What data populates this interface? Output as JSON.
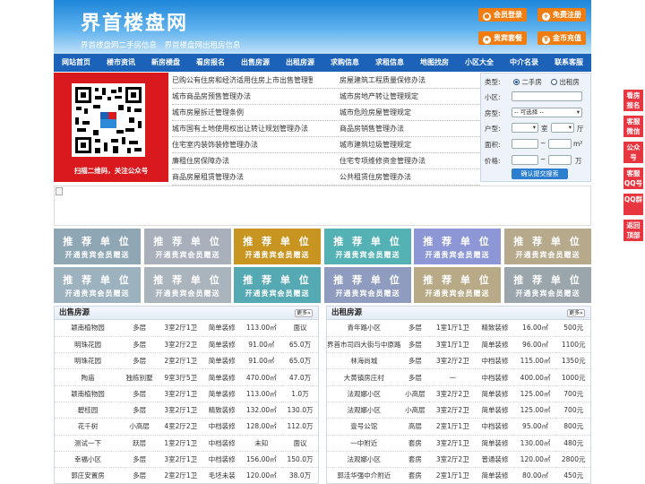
{
  "header": {
    "logo": "界首楼盘网",
    "slogan": "界首楼盘网二手房信息　界首楼盘网出租房信息",
    "buttons": [
      "会员登录",
      "免费注册",
      "贵宾套餐",
      "金币充值"
    ]
  },
  "nav": [
    "网站首页",
    "楼市资讯",
    "新房楼盘",
    "看房报名",
    "出售房源",
    "出租房源",
    "求购信息",
    "求租信息",
    "地图找房",
    "小区大全",
    "中介名录",
    "联系客服"
  ],
  "qr": {
    "caption": "扫描二维码，关注公众号"
  },
  "links": [
    [
      "已购公有住房和经济适用住房上市出售管理暂",
      "房屋建筑工程质量保修办法"
    ],
    [
      "城市商品房预售管理办法",
      "城市房地产转让管理规定"
    ],
    [
      "城市房屋拆迁管理条例",
      "城市危险房屋管理规定"
    ],
    [
      "城市国有土地使用权出让转让规划管理办法",
      "商品房销售管理办法"
    ],
    [
      "住宅室内装饰装修管理办法",
      "城市建筑垃圾管理规定"
    ],
    [
      "廉租住房保障办法",
      "住宅专项维修资金管理办法"
    ],
    [
      "商品房屋租赁管理办法",
      "公共租赁住房管理办法"
    ]
  ],
  "search": {
    "type_label": "类型:",
    "type_options": [
      "二手房",
      "出租房"
    ],
    "community_label": "小区:",
    "house_label": "房型:",
    "house_select": "-- 可选择 --",
    "layout_label": "户型:",
    "room_unit": "室",
    "hall_unit": "厅",
    "area_label": "面积:",
    "area_unit": "m²",
    "price_label": "价格:",
    "price_unit": "万",
    "submit": "确认提交搜索"
  },
  "tiles": {
    "line1": "推 荐 单 位",
    "line2": "开通贵宾会员赠送",
    "colors": [
      "#8fa6b4",
      "#a9b0bb",
      "#c79520",
      "#55b2b4",
      "#8d97d6",
      "#b6a98c",
      "#9cb2bf",
      "#aab4bc",
      "#55a9b3",
      "#8f9cbf",
      "#b8aa86",
      "#9aa6ac"
    ]
  },
  "sale": {
    "title": "出售房源",
    "more": "更多»",
    "rows": [
      [
        "颖南植物园",
        "多层",
        "3室2厅1卫",
        "简单装修",
        "113.00㎡",
        "面议"
      ],
      [
        "明珠花园",
        "多层",
        "3室2厅2卫",
        "简单装修",
        "91.00㎡",
        "65.0万"
      ],
      [
        "明珠花园",
        "多层",
        "2室2厅1卫",
        "简单装修",
        "91.00㎡",
        "65.0万"
      ],
      [
        "陶庙",
        "独栋别墅",
        "9室3厅5卫",
        "简单装修",
        "470.00㎡",
        "47.0万"
      ],
      [
        "颖南植物园",
        "多层",
        "3室2厅1卫",
        "简单装修",
        "113.00㎡",
        "1.0万"
      ],
      [
        "碧桂园",
        "多层",
        "3室2厅1卫",
        "精致装修",
        "132.00㎡",
        "130.0万"
      ],
      [
        "花千树",
        "小高层",
        "4室2厅2卫",
        "中档装修",
        "128.00㎡",
        "112.0万"
      ],
      [
        "测试一下",
        "跃层",
        "1室2厅1卫",
        "中档装修",
        "未知",
        "面议"
      ],
      [
        "幸福小区",
        "多层",
        "3室2厅1卫",
        "中档装修",
        "156.00㎡",
        "150.0万"
      ],
      [
        "郭庄安置房",
        "多层",
        "2室2厅1卫",
        "毛坯未装",
        "120.00㎡",
        "38.0万"
      ]
    ]
  },
  "rent": {
    "title": "出租房源",
    "more": "更多»",
    "rows": [
      [
        "青年路小区",
        "多层",
        "1室1厅1卫",
        "精致装修",
        "16.00㎡",
        "500元"
      ],
      [
        "界首市司四大街与中原路",
        "多层",
        "3室1厅1卫",
        "简单装修",
        "96.00㎡",
        "1100元"
      ],
      [
        "林海尚城",
        "多层",
        "3室2厅2卫",
        "中档装修",
        "115.00㎡",
        "1350元"
      ],
      [
        "大黄镇房庄村",
        "多层",
        "一",
        "中档装修",
        "400.00㎡",
        "1000元"
      ],
      [
        "法观娜小区",
        "小高层",
        "3室2厅2卫",
        "简单装修",
        "125.00㎡",
        "700元"
      ],
      [
        "法观娜小区",
        "小高层",
        "3室2厅2卫",
        "简单装修",
        "125.00㎡",
        "700元"
      ],
      [
        "壹号公馆",
        "高层",
        "2室1厅1卫",
        "中档装修",
        "95.00㎡",
        "800元"
      ],
      [
        "一中附近",
        "套房",
        "3室2厅1卫",
        "简单装修",
        "130.00㎡",
        "480元"
      ],
      [
        "法观娜小区",
        "套房",
        "3室2厅2卫",
        "普通装修",
        "120.00㎡",
        "2800元"
      ],
      [
        "郭洼华强中介附近",
        "套房",
        "2室1厅1卫",
        "简单装修",
        "80.00㎡",
        "450元"
      ]
    ]
  },
  "side": [
    "看房报名",
    "客服微信",
    "公众号",
    "客服QQ号",
    "QQ群",
    "返回顶部"
  ]
}
